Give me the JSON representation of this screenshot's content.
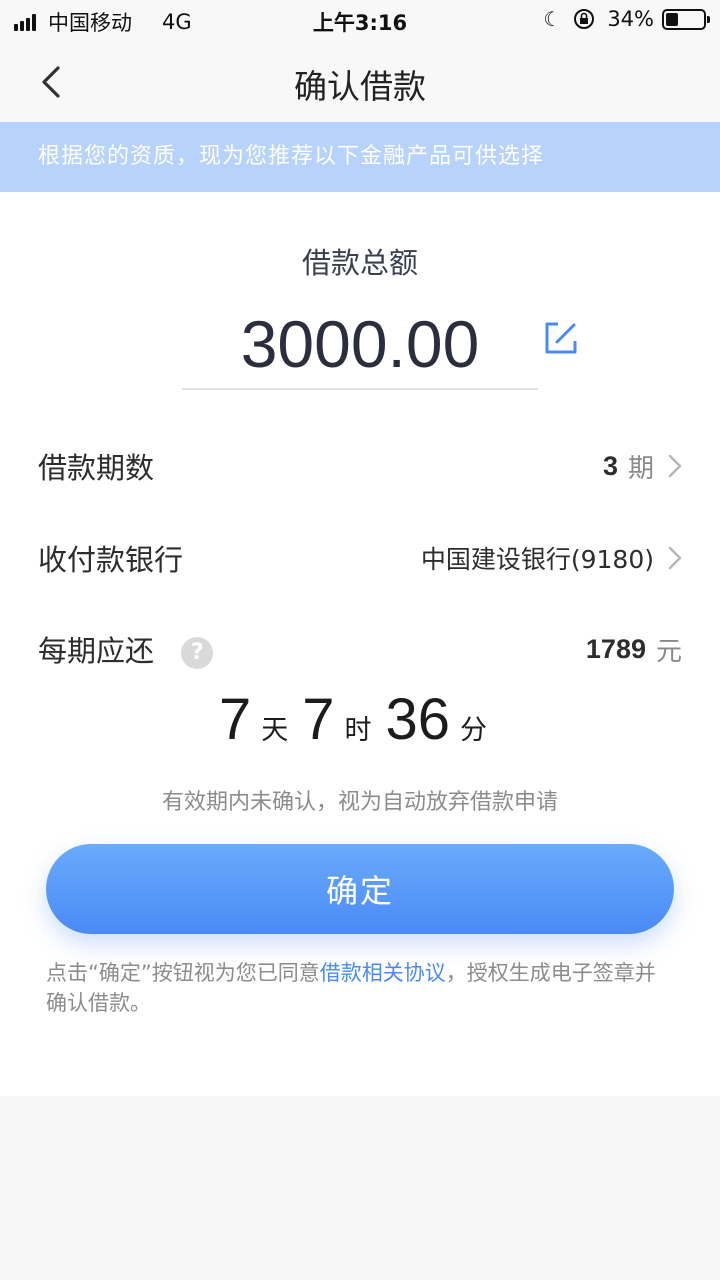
{
  "status_bar": {
    "carrier": "中国移动",
    "network": "4G",
    "time": "上午3:16",
    "battery_text": "34%",
    "battery_level": 0.34
  },
  "nav": {
    "title": "确认借款",
    "back_icon": "chevron-left-icon"
  },
  "notice": {
    "text": "根据您的资质，现为您推荐以下金融产品可供选择"
  },
  "loan": {
    "amount_label": "借款总额",
    "amount_value": "3000.00",
    "edit_icon": "edit-icon"
  },
  "rows": {
    "term": {
      "label": "借款期数",
      "value": "3",
      "unit": "期"
    },
    "bank": {
      "label": "收付款银行",
      "value": "中国建设银行(9180)"
    },
    "repay": {
      "label": "每期应还",
      "value": "1789",
      "unit": "元",
      "help_symbol": "?"
    }
  },
  "countdown": {
    "days": "7",
    "days_unit": "天",
    "hours": "7",
    "hours_unit": "时",
    "minutes": "36",
    "minutes_unit": "分"
  },
  "expire_note": "有效期内未确认，视为自动放弃借款申请",
  "confirm_button": "确定",
  "agreement": {
    "prefix": "点击“确定”按钮视为您已同意",
    "link": "借款相关协议",
    "suffix": "，授权生成电子签章并确认借款。"
  },
  "colors": {
    "accent": "#4a8af5",
    "notice_bg": "#b7d2fb",
    "page_bg": "#f7f7f8"
  }
}
